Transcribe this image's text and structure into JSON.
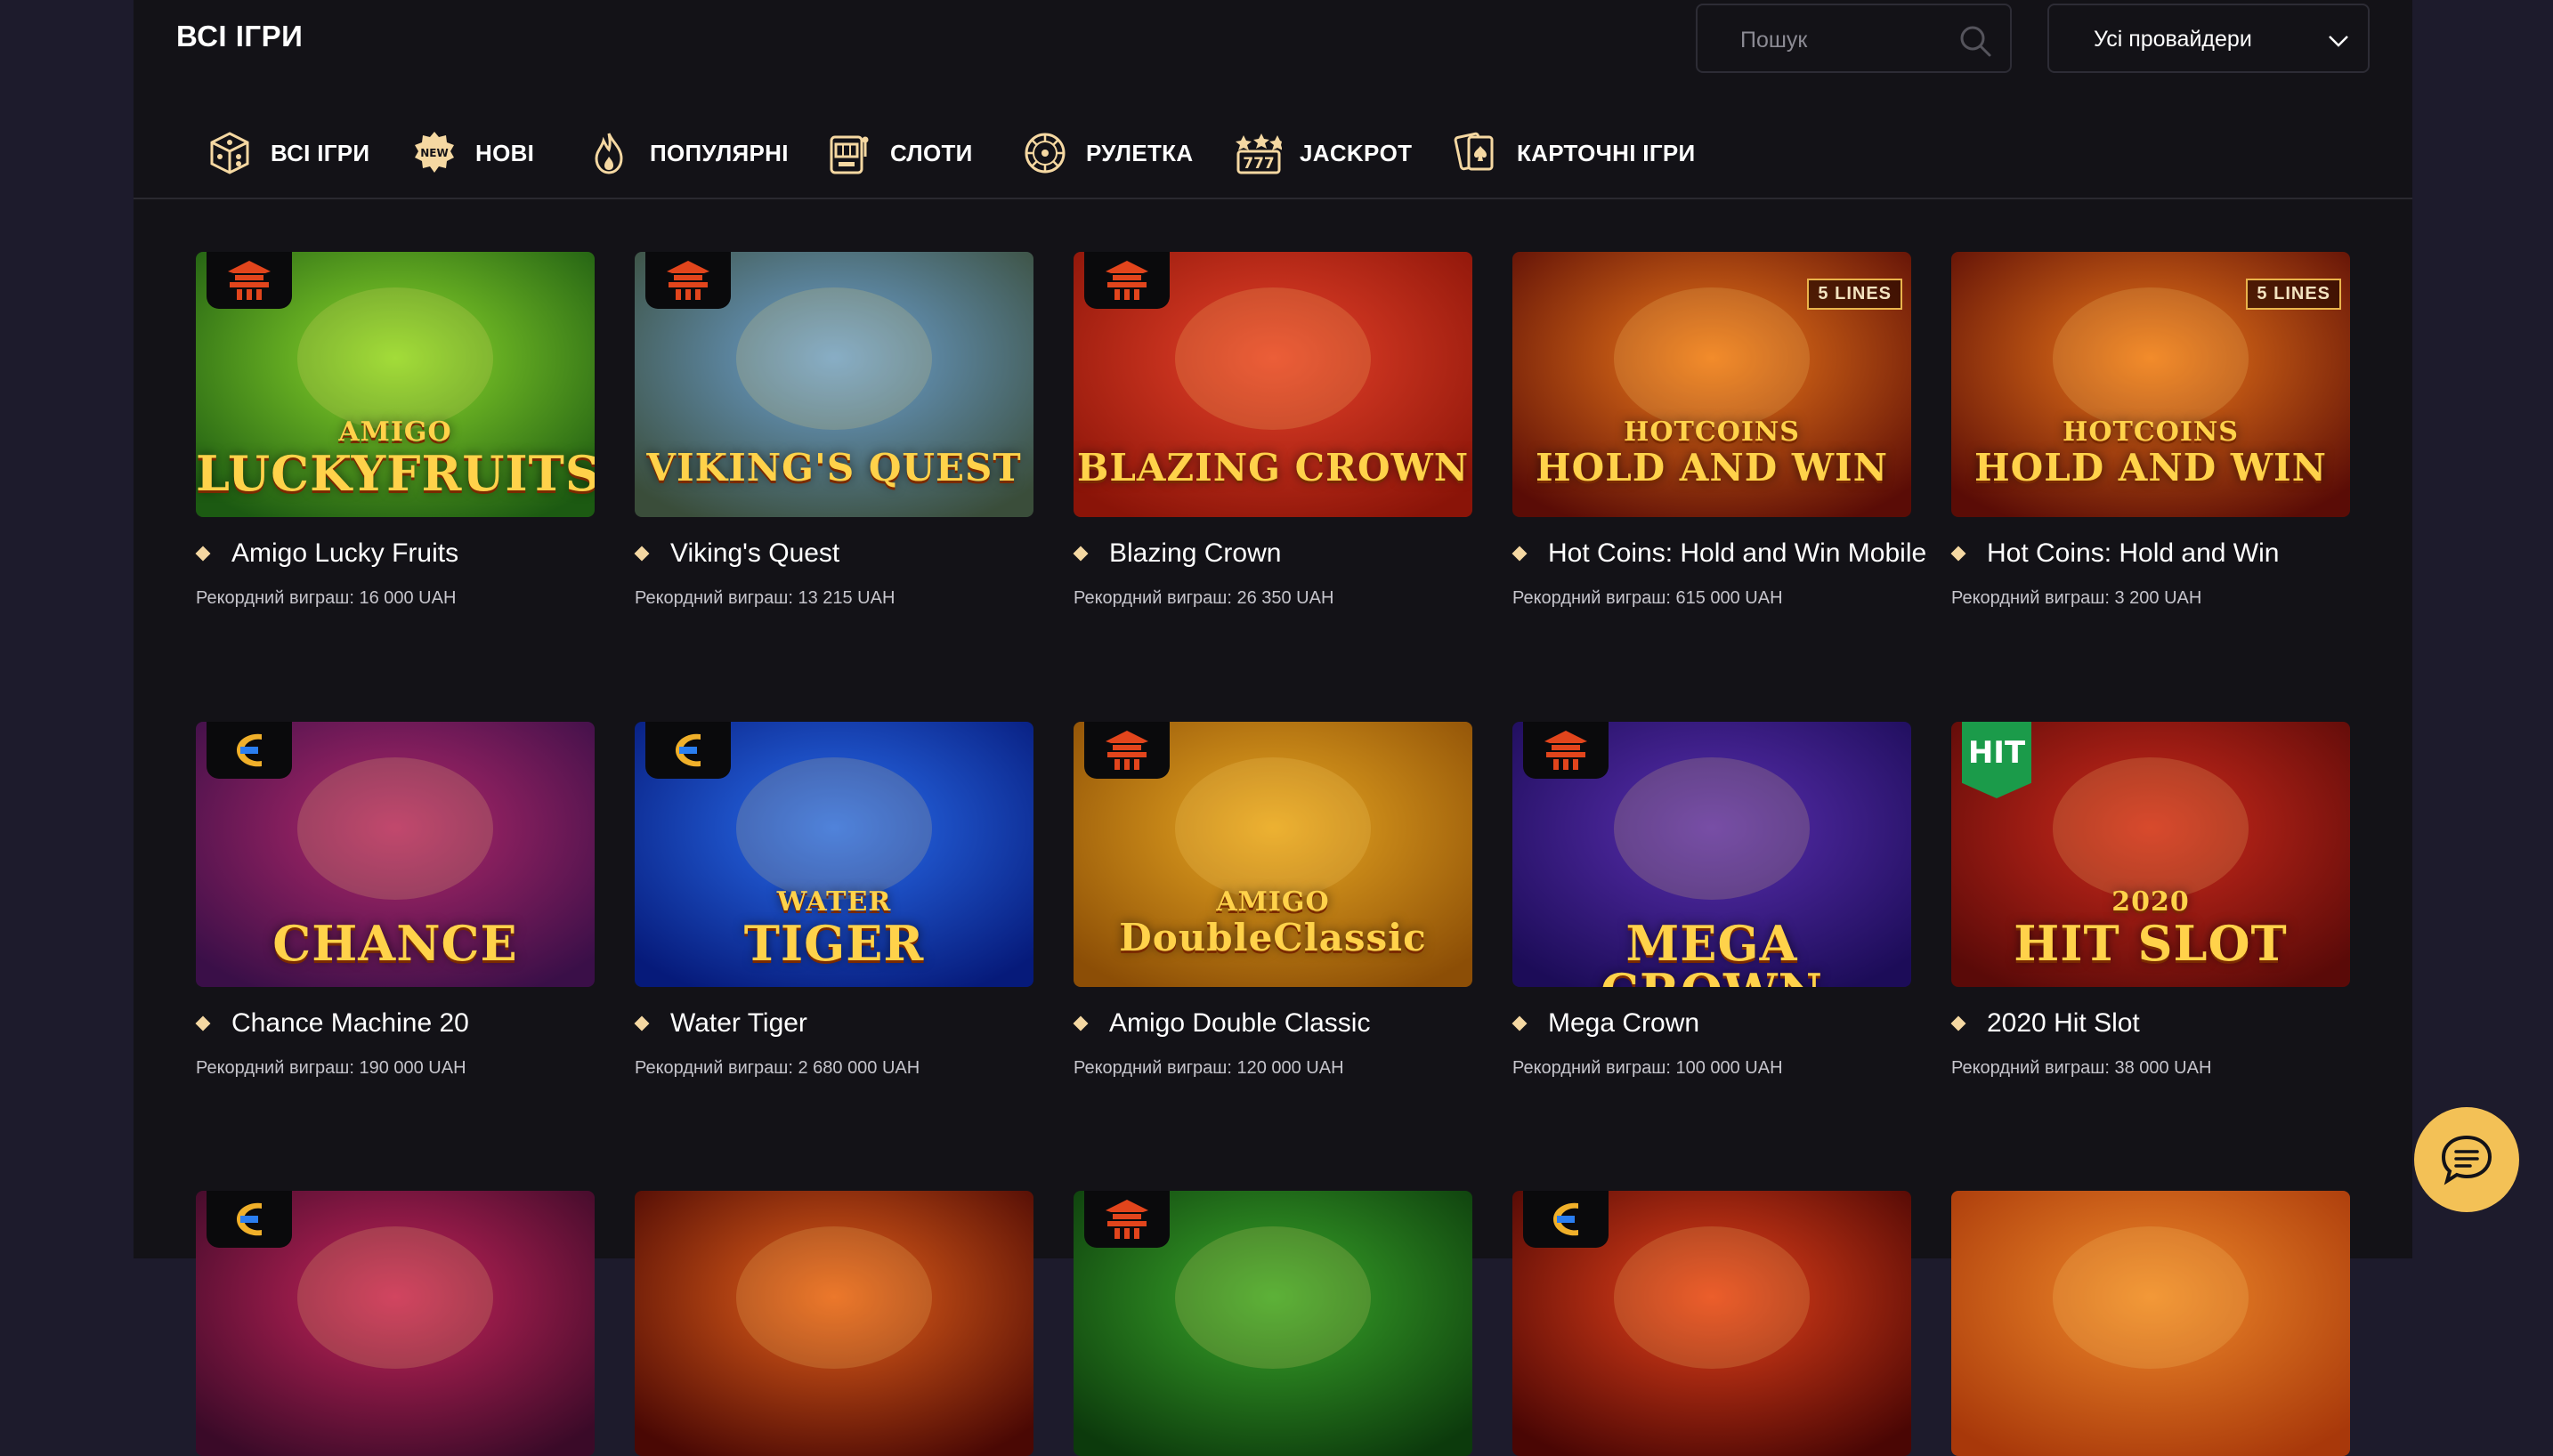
{
  "header": {
    "title": "ВСІ ІГРИ",
    "search_placeholder": "Пошук",
    "provider_selected": "Усі провайдери"
  },
  "categories": [
    {
      "label": "ВСІ ІГРИ",
      "icon": "dice-icon"
    },
    {
      "label": "НОВІ",
      "icon": "new-badge-icon"
    },
    {
      "label": "ПОПУЛЯРНІ",
      "icon": "fire-icon"
    },
    {
      "label": "СЛОТИ",
      "icon": "slot-machine-icon"
    },
    {
      "label": "РУЛЕТКА",
      "icon": "roulette-icon"
    },
    {
      "label": "JACKPOT",
      "icon": "jackpot-777-icon"
    },
    {
      "label": "КАРТОЧНІ ІГРИ",
      "icon": "cards-icon"
    }
  ],
  "games": [
    {
      "title": "Amigo Lucky Fruits",
      "record": "Рекордний виграш: 16 000 UAH",
      "art_line1": "AMIGO",
      "art_line2": "LUCKYFRUITS",
      "provider_badge": "pagoda-icon",
      "colors": [
        "#8fdc2b",
        "#1c5a12"
      ]
    },
    {
      "title": "Viking's Quest",
      "record": "Рекордний виграш: 13 215 UAH",
      "art_line1": "",
      "art_line2": "VIKING'S QUEST",
      "provider_badge": "pagoda-icon",
      "colors": [
        "#6ea3d6",
        "#3a4d3a"
      ]
    },
    {
      "title": "Blazing Crown",
      "record": "Рекордний виграш: 26 350 UAH",
      "art_line1": "",
      "art_line2": "BLAZING CROWN",
      "provider_badge": "pagoda-icon",
      "colors": [
        "#e8422a",
        "#8a1408"
      ]
    },
    {
      "title": "Hot Coins: Hold and Win Mobile",
      "record": "Рекордний виграш: 615 000 UAH",
      "art_line1": "HOTCOINS",
      "art_line2": "HOLD AND WIN",
      "provider_badge": "",
      "lines_badge": "5 LINES",
      "colors": [
        "#f07a1a",
        "#5a0c06"
      ]
    },
    {
      "title": "Hot Coins: Hold and Win",
      "record": "Рекордний виграш: 3 200 UAH",
      "art_line1": "HOTCOINS",
      "art_line2": "HOLD AND WIN",
      "provider_badge": "",
      "lines_badge": "5 LINES",
      "colors": [
        "#f07a1a",
        "#5a0c06"
      ]
    },
    {
      "title": "Chance Machine 20",
      "record": "Рекордний виграш: 190 000 UAH",
      "art_line1": "",
      "art_line2": "CHANCE",
      "provider_badge": "endorphina-icon",
      "colors": [
        "#b4286a",
        "#3a0f48"
      ]
    },
    {
      "title": "Water Tiger",
      "record": "Рекордний виграш: 2 680 000 UAH",
      "art_line1": "WATER",
      "art_line2": "TIGER",
      "provider_badge": "endorphina-icon",
      "colors": [
        "#2a6ff0",
        "#061a7a"
      ]
    },
    {
      "title": "Amigo Double Classic",
      "record": "Рекордний виграш: 120 000 UAH",
      "art_line1": "AMIGO",
      "art_line2": "DoubleClassic",
      "provider_badge": "pagoda-icon",
      "colors": [
        "#e9a822",
        "#8c4e06"
      ]
    },
    {
      "title": "Mega Crown",
      "record": "Рекордний виграш: 100 000 UAH",
      "art_line1": "",
      "art_line2": "MEGA CROWN",
      "provider_badge": "pagoda-icon",
      "colors": [
        "#5a2fb0",
        "#1c0c58"
      ]
    },
    {
      "title": "2020 Hit Slot",
      "record": "Рекордний виграш: 38 000 UAH",
      "art_line1": "2020",
      "art_line2": "HIT SLOT",
      "provider_badge": "hit-badge",
      "hit_label": "HIT",
      "colors": [
        "#d02a1c",
        "#5a0a08"
      ]
    }
  ],
  "row3_colors": [
    [
      "#c8245a",
      "#3a0a28"
    ],
    [
      "#e8621a",
      "#4a0804"
    ],
    [
      "#3aa82a",
      "#0c3a0c"
    ],
    [
      "#e8421a",
      "#4a0604"
    ],
    [
      "#f08a2a",
      "#a8380a"
    ]
  ],
  "row3_badges": [
    "endorphina-icon",
    "",
    "pagoda-icon",
    "endorphina-icon",
    ""
  ],
  "chat": {
    "icon": "chat-icon"
  }
}
